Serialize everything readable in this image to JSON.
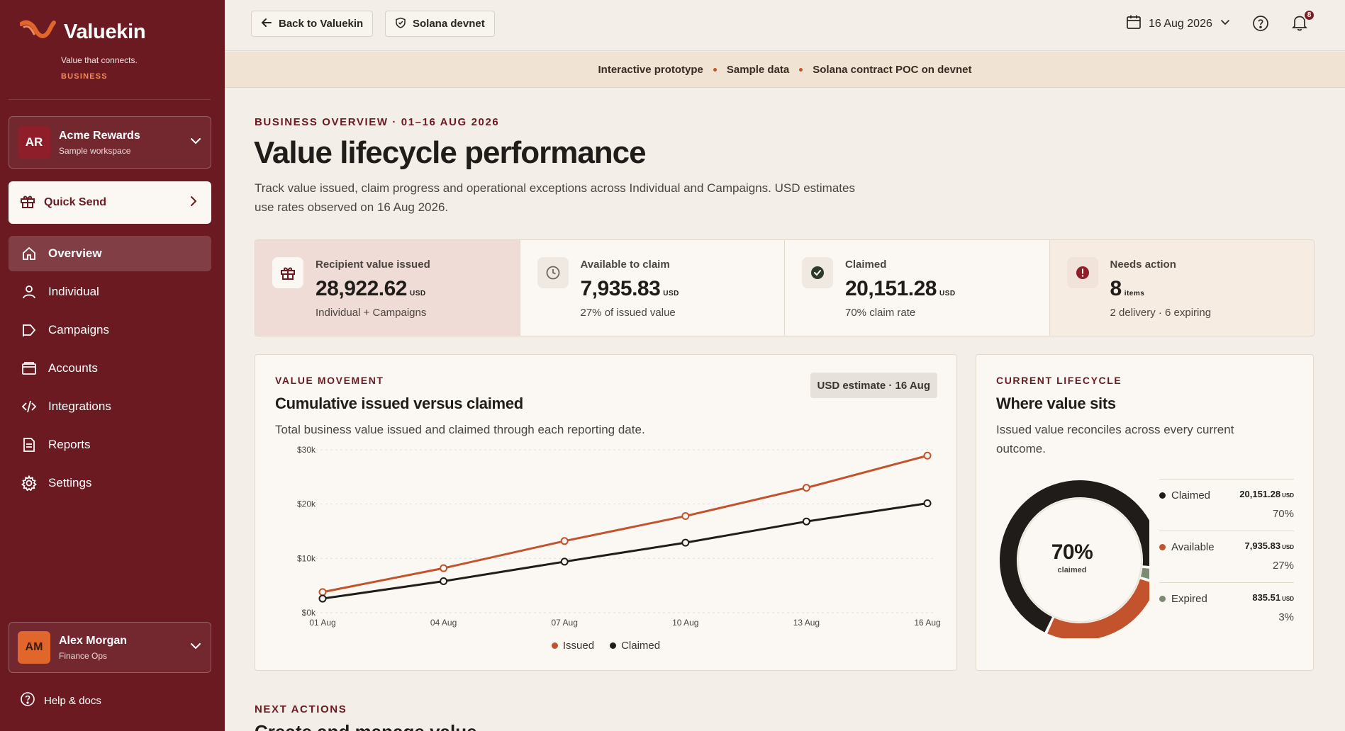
{
  "sidebar": {
    "brand": "Valuekin",
    "tagline": "Value that connects.",
    "segment": "BUSINESS",
    "workspace": {
      "initials": "AR",
      "name": "Acme Rewards",
      "sub": "Sample workspace"
    },
    "quick_send": "Quick Send",
    "nav": [
      {
        "label": "Overview",
        "icon": "home-icon",
        "active": true
      },
      {
        "label": "Individual",
        "icon": "person-icon"
      },
      {
        "label": "Campaigns",
        "icon": "megaphone-icon"
      },
      {
        "label": "Accounts",
        "icon": "wallet-icon"
      },
      {
        "label": "Integrations",
        "icon": "code-icon"
      },
      {
        "label": "Reports",
        "icon": "document-icon"
      },
      {
        "label": "Settings",
        "icon": "gear-icon"
      }
    ],
    "user": {
      "initials": "AM",
      "name": "Alex Morgan",
      "role": "Finance Ops"
    },
    "help": "Help & docs"
  },
  "topbar": {
    "back": "Back to Valuekin",
    "network": "Solana devnet",
    "date": "16 Aug 2026",
    "notifications": "8"
  },
  "banner": [
    "Interactive prototype",
    "Sample data",
    "Solana contract POC on devnet"
  ],
  "page": {
    "eyebrow": "BUSINESS OVERVIEW · 01–16 AUG 2026",
    "title": "Value lifecycle performance",
    "description": "Track value issued, claim progress and operational exceptions across Individual and Campaigns. USD estimates use rates observed on 16 Aug 2026."
  },
  "kpis": [
    {
      "label": "Recipient value issued",
      "value": "28,922.62",
      "unit": "USD",
      "sub": "Individual + Campaigns",
      "icon": "gift-icon"
    },
    {
      "label": "Available to claim",
      "value": "7,935.83",
      "unit": "USD",
      "sub": "27% of issued value",
      "icon": "clock-icon"
    },
    {
      "label": "Claimed",
      "value": "20,151.28",
      "unit": "USD",
      "sub": "70% claim rate",
      "icon": "check-circle-icon"
    },
    {
      "label": "Needs action",
      "value": "8",
      "unit": "items",
      "sub": "2 delivery · 6 expiring",
      "icon": "alert-icon"
    }
  ],
  "value_movement": {
    "eyebrow": "VALUE MOVEMENT",
    "title": "Cumulative issued versus claimed",
    "description": "Total business value issued and claimed through each reporting date.",
    "pill": "USD estimate · 16 Aug"
  },
  "chart_data": {
    "type": "line",
    "x": [
      "01 Aug",
      "04 Aug",
      "07 Aug",
      "10 Aug",
      "13 Aug",
      "16 Aug"
    ],
    "y_ticks": [
      "$0k",
      "$10k",
      "$20k",
      "$30k"
    ],
    "ylim": [
      0,
      30000
    ],
    "series": [
      {
        "name": "Issued",
        "values": [
          3800,
          8200,
          13200,
          17800,
          23000,
          28922.62
        ],
        "color": "#c2532c"
      },
      {
        "name": "Claimed",
        "values": [
          2600,
          5800,
          9400,
          12900,
          16800,
          20151.28
        ],
        "color": "#1f1c1a"
      }
    ],
    "grid": true,
    "legend": "bottom-center"
  },
  "lifecycle": {
    "eyebrow": "CURRENT LIFECYCLE",
    "title": "Where value sits",
    "description": "Issued value reconciles across every current outcome.",
    "center_pct": "70%",
    "center_caption": "claimed",
    "items": [
      {
        "name": "Claimed",
        "value": "20,151.28",
        "unit": "USD",
        "pct": "70%",
        "share": 0.6967,
        "color": "#1f1c1a"
      },
      {
        "name": "Available",
        "value": "7,935.83",
        "unit": "USD",
        "pct": "27%",
        "share": 0.2744,
        "color": "#c2532c"
      },
      {
        "name": "Expired",
        "value": "835.51",
        "unit": "USD",
        "pct": "3%",
        "share": 0.0289,
        "color": "#7d8a72"
      }
    ]
  },
  "next": {
    "eyebrow": "NEXT ACTIONS",
    "title": "Create and manage value"
  }
}
